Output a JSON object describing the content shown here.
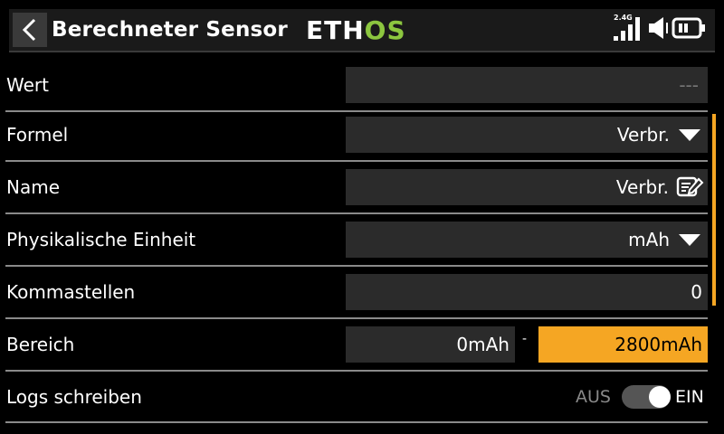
{
  "header": {
    "title": "Berechneter Sensor",
    "logo_left": "ETH",
    "logo_right": "OS",
    "signal_label": "2.4G"
  },
  "rows": {
    "wert": {
      "label": "Wert",
      "value": "---"
    },
    "formel": {
      "label": "Formel",
      "value": "Verbr."
    },
    "name": {
      "label": "Name",
      "value": "Verbr."
    },
    "einheit": {
      "label": "Physikalische Einheit",
      "value": "mAh"
    },
    "komma": {
      "label": "Kommastellen",
      "value": "0"
    },
    "bereich": {
      "label": "Bereich",
      "min": "0mAh",
      "separator": "-",
      "max": "2800mAh"
    },
    "logs": {
      "label": "Logs schreiben",
      "off_label": "AUS",
      "on_label": "EIN",
      "state": "on"
    }
  },
  "colors": {
    "accent": "#f5a623",
    "logo_green": "#8cc63f",
    "field_bg": "#2b2b2b",
    "background": "#000000"
  }
}
